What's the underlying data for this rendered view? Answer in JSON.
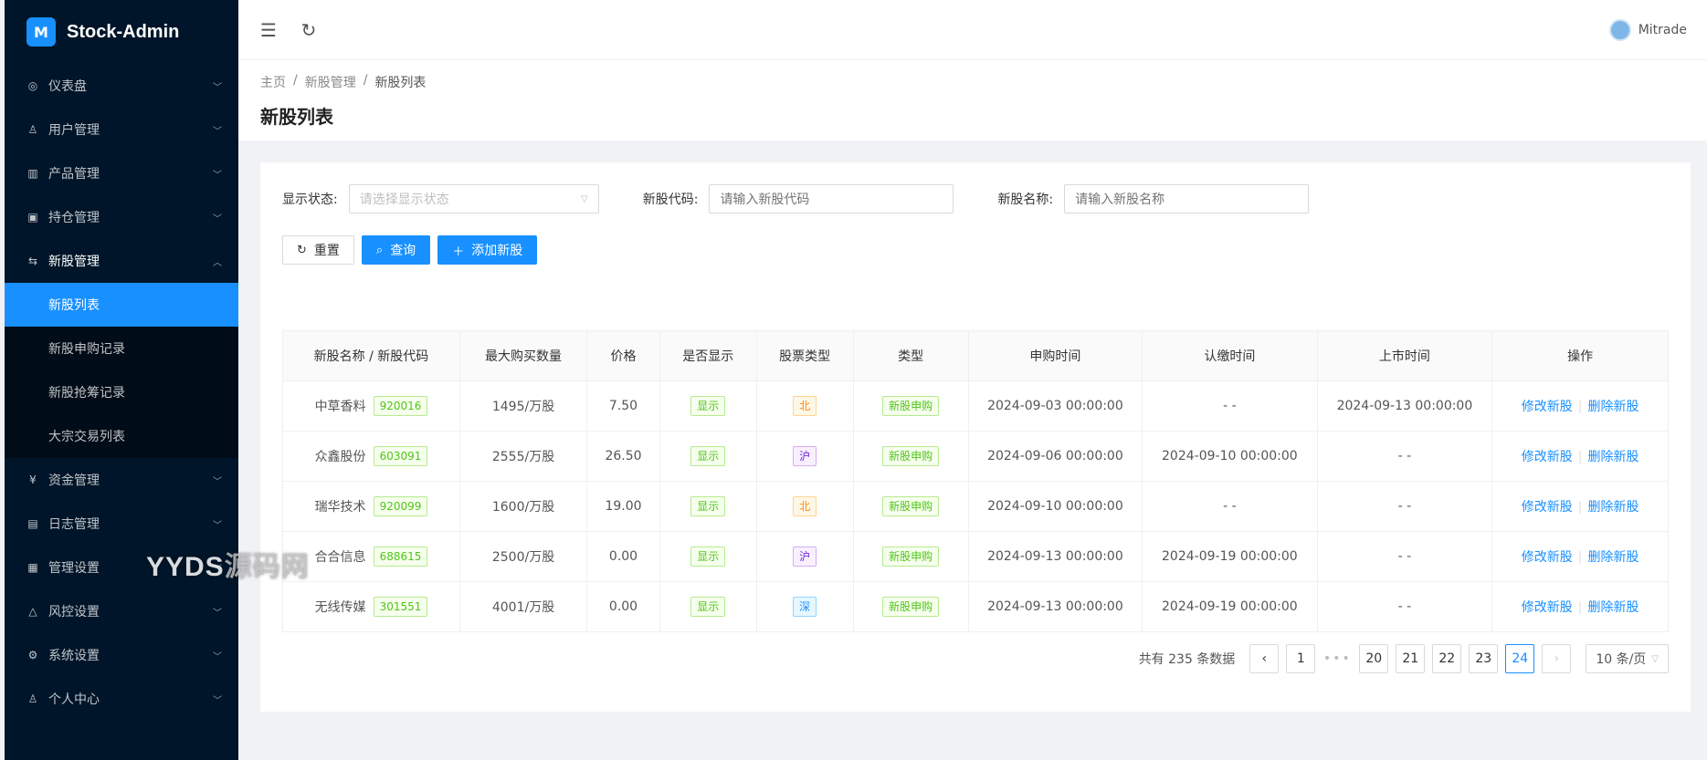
{
  "app": {
    "title": "Stock-Admin",
    "logo_glyph": "M"
  },
  "sidebar": {
    "items": [
      {
        "label": "仪表盘",
        "icon": "dashboard-icon",
        "glyph": "◎"
      },
      {
        "label": "用户管理",
        "icon": "user-group-icon",
        "glyph": "♙"
      },
      {
        "label": "产品管理",
        "icon": "chart-icon",
        "glyph": "▥"
      },
      {
        "label": "持仓管理",
        "icon": "position-icon",
        "glyph": "▣"
      },
      {
        "label": "新股管理",
        "icon": "ipo-icon",
        "glyph": "⇆",
        "open": true
      },
      {
        "label": "资金管理",
        "icon": "money-icon",
        "glyph": "¥"
      },
      {
        "label": "日志管理",
        "icon": "log-icon",
        "glyph": "▤"
      },
      {
        "label": "管理设置",
        "icon": "admin-settings-icon",
        "glyph": "▦"
      },
      {
        "label": "风控设置",
        "icon": "warning-icon",
        "glyph": "△"
      },
      {
        "label": "系统设置",
        "icon": "gear-icon",
        "glyph": "⚙"
      },
      {
        "label": "个人中心",
        "icon": "person-icon",
        "glyph": "♙"
      }
    ],
    "submenu": [
      {
        "label": "新股列表",
        "active": true
      },
      {
        "label": "新股申购记录"
      },
      {
        "label": "新股抢筹记录"
      },
      {
        "label": "大宗交易列表"
      }
    ],
    "watermark_a": "YYDS",
    "watermark_b": "源码网"
  },
  "header": {
    "collapse_glyph": "☰",
    "refresh_glyph": "↻",
    "username": "Mitrade"
  },
  "breadcrumb": [
    "主页",
    "新股管理",
    "新股列表"
  ],
  "page_title": "新股列表",
  "filters": {
    "status_label": "显示状态:",
    "status_placeholder": "请选择显示状态",
    "code_label": "新股代码:",
    "code_placeholder": "请输入新股代码",
    "name_label": "新股名称:",
    "name_placeholder": "请输入新股名称"
  },
  "buttons": {
    "reset": "重置",
    "query": "查询",
    "add": "添加新股"
  },
  "table": {
    "headers": [
      "新股名称 / 新股代码",
      "最大购买数量",
      "价格",
      "是否显示",
      "股票类型",
      "类型",
      "申购时间",
      "认缴时间",
      "上市时间",
      "操作"
    ],
    "rows": [
      {
        "name": "中草香料",
        "code": "920016",
        "max": "1495/万股",
        "price": "7.50",
        "show": "显示",
        "market": "北",
        "market_color": "orange",
        "type": "新股申购",
        "apply": "2024-09-03 00:00:00",
        "pay": "- -",
        "list": "2024-09-13 00:00:00"
      },
      {
        "name": "众鑫股份",
        "code": "603091",
        "max": "2555/万股",
        "price": "26.50",
        "show": "显示",
        "market": "沪",
        "market_color": "purple",
        "type": "新股申购",
        "apply": "2024-09-06 00:00:00",
        "pay": "2024-09-10 00:00:00",
        "list": "- -"
      },
      {
        "name": "瑞华技术",
        "code": "920099",
        "max": "1600/万股",
        "price": "19.00",
        "show": "显示",
        "market": "北",
        "market_color": "orange",
        "type": "新股申购",
        "apply": "2024-09-10 00:00:00",
        "pay": "- -",
        "list": "- -"
      },
      {
        "name": "合合信息",
        "code": "688615",
        "max": "2500/万股",
        "price": "0.00",
        "show": "显示",
        "market": "沪",
        "market_color": "purple",
        "type": "新股申购",
        "apply": "2024-09-13 00:00:00",
        "pay": "2024-09-19 00:00:00",
        "list": "- -"
      },
      {
        "name": "无线传媒",
        "code": "301551",
        "max": "4001/万股",
        "price": "0.00",
        "show": "显示",
        "market": "深",
        "market_color": "cyan",
        "type": "新股申购",
        "apply": "2024-09-13 00:00:00",
        "pay": "2024-09-19 00:00:00",
        "list": "- -"
      }
    ],
    "action_edit": "修改新股",
    "action_delete": "删除新股"
  },
  "pagination": {
    "total_text": "共有 235 条数据",
    "pages": [
      "1",
      "20",
      "21",
      "22",
      "23",
      "24"
    ],
    "current": "24",
    "page_size": "10 条/页"
  }
}
